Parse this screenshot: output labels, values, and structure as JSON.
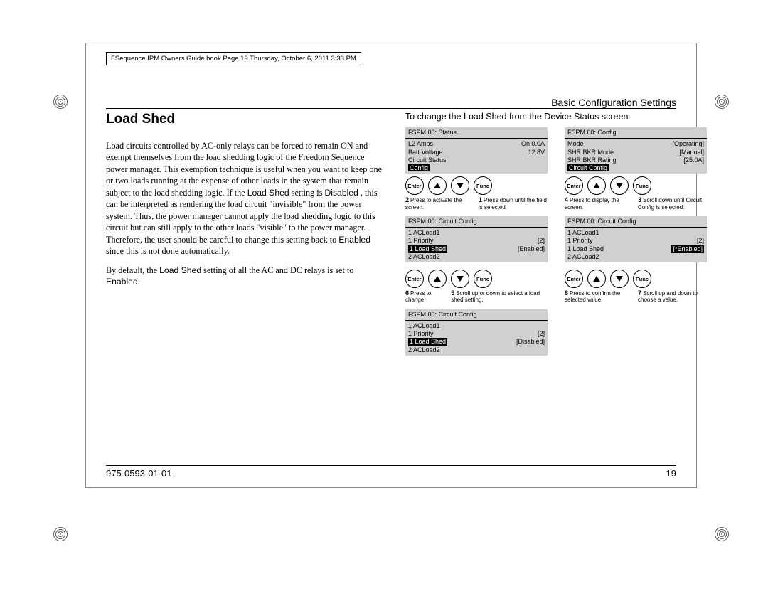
{
  "scan_meta": "FSequence IPM Owners Guide.book  Page 19  Thursday, October 6, 2011  3:33 PM",
  "header_right": "Basic Configuration Settings",
  "section_title": "Load Shed",
  "para1_a": "Load circuits controlled by AC-only relays can be forced to remain ON and exempt themselves from the load shedding logic of the Freedom Sequence power manager. This exemption technique is useful when you want to keep one or two loads running at the expense of other loads in the system that remain subject to the load shedding logic. If the ",
  "para1_b": "Load Shed",
  "para1_c": " setting is ",
  "para1_d": "Disabled",
  "para1_e": " , this can be interpreted as rendering the load circuit \"invisible\" from the power system. Thus, the power manager cannot apply the load shedding logic to this circuit but can still apply to the other loads \"visible\" to the power manager. Therefore, the user should be careful to change this setting back to ",
  "para1_f": "Enabled",
  "para1_g": " since this is not done automatically.",
  "para2_a": "By default, the ",
  "para2_b": "Load Shed",
  "para2_c": " setting of all the AC and DC relays is set to ",
  "para2_d": "Enabled",
  "para2_e": ".",
  "change_a": "To change the ",
  "change_b": "Load Shed",
  "change_c": " from the Device ",
  "change_d": "Status",
  "change_e": "  screen:",
  "btn_enter": "Enter",
  "btn_func": "Func",
  "screen1": {
    "title": "FSPM 00: Status",
    "rows": [
      [
        "L2 Amps",
        "On 0.0A"
      ],
      [
        "Batt Voltage",
        "12.8V"
      ],
      [
        "Circuit Status",
        ""
      ]
    ],
    "sel": "Config"
  },
  "screen2": {
    "title": "FSPM 00: Config",
    "rows": [
      [
        "Mode",
        "[Operating]"
      ],
      [
        "SHR BKR Mode",
        "[Manual]"
      ],
      [
        "SHR BKR Rating",
        "[25.0A]"
      ]
    ],
    "sel": "Circuit Config"
  },
  "step2": "Press to activate the screen.",
  "step1": "Press down until the field is selected.",
  "step4": "Press to display the screen.",
  "step3": "Scroll down until Circuit Config is selected.",
  "screen3": {
    "title": "FSPM 00: Circuit Config",
    "r1": "1 ACLoad1",
    "r2l": "1 Priority",
    "r2r": "[2]",
    "r3l": "1 Load Shed",
    "r3r": "[Enabled]",
    "r4": "2 ACLoad2"
  },
  "screen4": {
    "title": "FSPM 00: Circuit Config",
    "r1": "1 ACLoad1",
    "r2l": "1 Priority",
    "r2r": "[2]",
    "r3l": "1 Load Shed",
    "r3r": "[*Enabled]",
    "r4": "2 ACLoad2"
  },
  "step6": "Press to change.",
  "step5": "Scroll up or down to select a load shed setting.",
  "step8": "Press to confirm the selected value.",
  "step7": "Scroll up and down to choose a value.",
  "screen5": {
    "title": "FSPM 00: Circuit Config",
    "r1": "1 ACLoad1",
    "r2l": "1 Priority",
    "r2r": "[2]",
    "r3l": "1 Load Shed",
    "r3r": "[Disabled]",
    "r4": "2 ACLoad2"
  },
  "footer_left": "975-0593-01-01",
  "footer_right": "19"
}
